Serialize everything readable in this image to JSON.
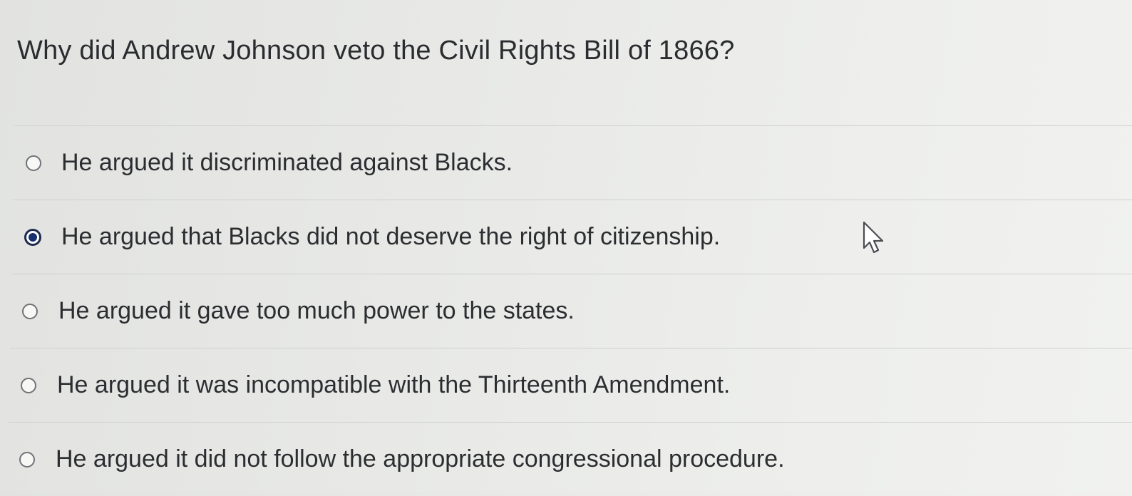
{
  "question": {
    "text": "Why did Andrew Johnson veto the Civil Rights Bill of 1866?"
  },
  "answers": [
    {
      "label": "He argued it discriminated against Blacks.",
      "selected": false
    },
    {
      "label": "He argued that Blacks did not deserve the right of citizenship.",
      "selected": true
    },
    {
      "label": "He argued it gave too much power to the states.",
      "selected": false
    },
    {
      "label": "He argued it was incompatible with the Thirteenth Amendment.",
      "selected": false
    },
    {
      "label": "He argued it did not follow the appropriate congressional procedure.",
      "selected": false
    }
  ],
  "colors": {
    "radio_selected": "#14306e",
    "text": "#2b2d30",
    "background": "#e9eae8"
  },
  "icons": {
    "pointer": "mouse-pointer-icon"
  }
}
